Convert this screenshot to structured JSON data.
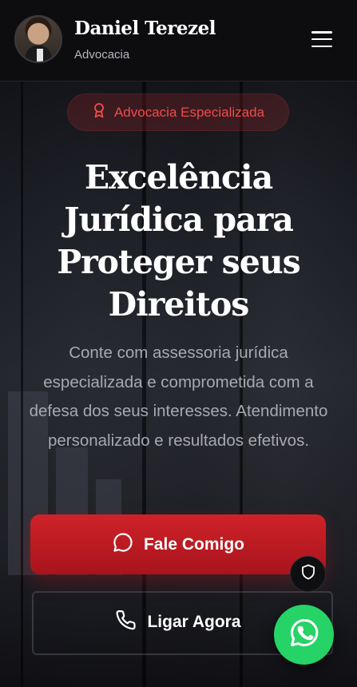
{
  "header": {
    "name": "Daniel Terezel",
    "subtitle": "Advocacia",
    "avatar_icon": "lawyer-portrait",
    "menu_icon": "hamburger-icon"
  },
  "hero": {
    "badge": {
      "icon": "award-icon",
      "label": "Advocacia Especializada"
    },
    "title": "Excelência Jurídica para Proteger seus Direitos",
    "lead": "Conte com assessoria jurídica especializada e comprometida com a defesa dos seus interesses. Atendimento personalizado e resultados efetivos.",
    "primary_cta": {
      "icon": "chat-bubble-icon",
      "label": "Fale Comigo"
    },
    "secondary_cta": {
      "icon": "phone-icon",
      "label": "Ligar Agora"
    }
  },
  "floating": {
    "shield_icon": "shield-icon",
    "whatsapp_icon": "whatsapp-icon"
  },
  "colors": {
    "accent": "#c81e26",
    "badge_text": "#ef4b4b",
    "whatsapp": "#25d366",
    "header_bg": "#0d0d10"
  }
}
